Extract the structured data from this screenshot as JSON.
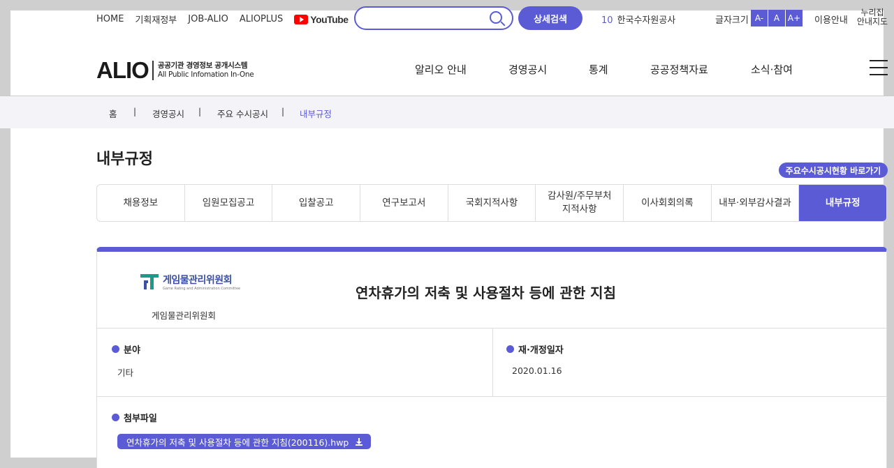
{
  "top_links": [
    "HOME",
    "기획재정부",
    "JOB-ALIO",
    "ALIOPLUS"
  ],
  "youtube_label": "YouTube",
  "search": {
    "placeholder": "",
    "button_label": "상세검색"
  },
  "ticker": {
    "rank": "10",
    "text": "한국수자원공사"
  },
  "font_size": {
    "label": "글자크기",
    "buttons": [
      "A-",
      "A",
      "A+"
    ]
  },
  "usage_label": "이용안내",
  "nuri_label_1": "누리집",
  "nuri_label_2": "안내지도",
  "logo": {
    "text": "ALIO",
    "sub1": "공공기관 경영정보 공개시스템",
    "sub2": "All Public Infomation In-One"
  },
  "gnb": [
    "알리오 안내",
    "경영공시",
    "통계",
    "공공정책자료",
    "소식·참여"
  ],
  "breadcrumb": [
    "홈",
    "경영공시",
    "주요 수시공시",
    "내부규정"
  ],
  "page_title": "내부규정",
  "shortcut_label": "주요수시공시현황 바로가기",
  "tabs": [
    "채용정보",
    "임원모집공고",
    "입찰공고",
    "연구보고서",
    "국회지적사항",
    "감사원/주무부처\n지적사항",
    "이사회회의록",
    "내부·외부감사결과",
    "내부규정"
  ],
  "detail": {
    "org_wordmark": "게임물관리위원회",
    "org_wordmark_en": "Game Rating and Administration Committee",
    "org_name": "게임물관리위원회",
    "title": "연차휴가의 저축 및 사용절차 등에 관한 지침",
    "field_label": "분야",
    "field_value": "기타",
    "date_label": "재·개정일자",
    "date_value": "2020.01.16",
    "attach_label": "첨부파일",
    "attach_file": "연차휴가의 저축 및 사용절차 등에 관한 지침(200116).hwp"
  },
  "colors": {
    "accent": "#5b5bd6",
    "breadcrumb_bg": "#f3f3f8"
  }
}
